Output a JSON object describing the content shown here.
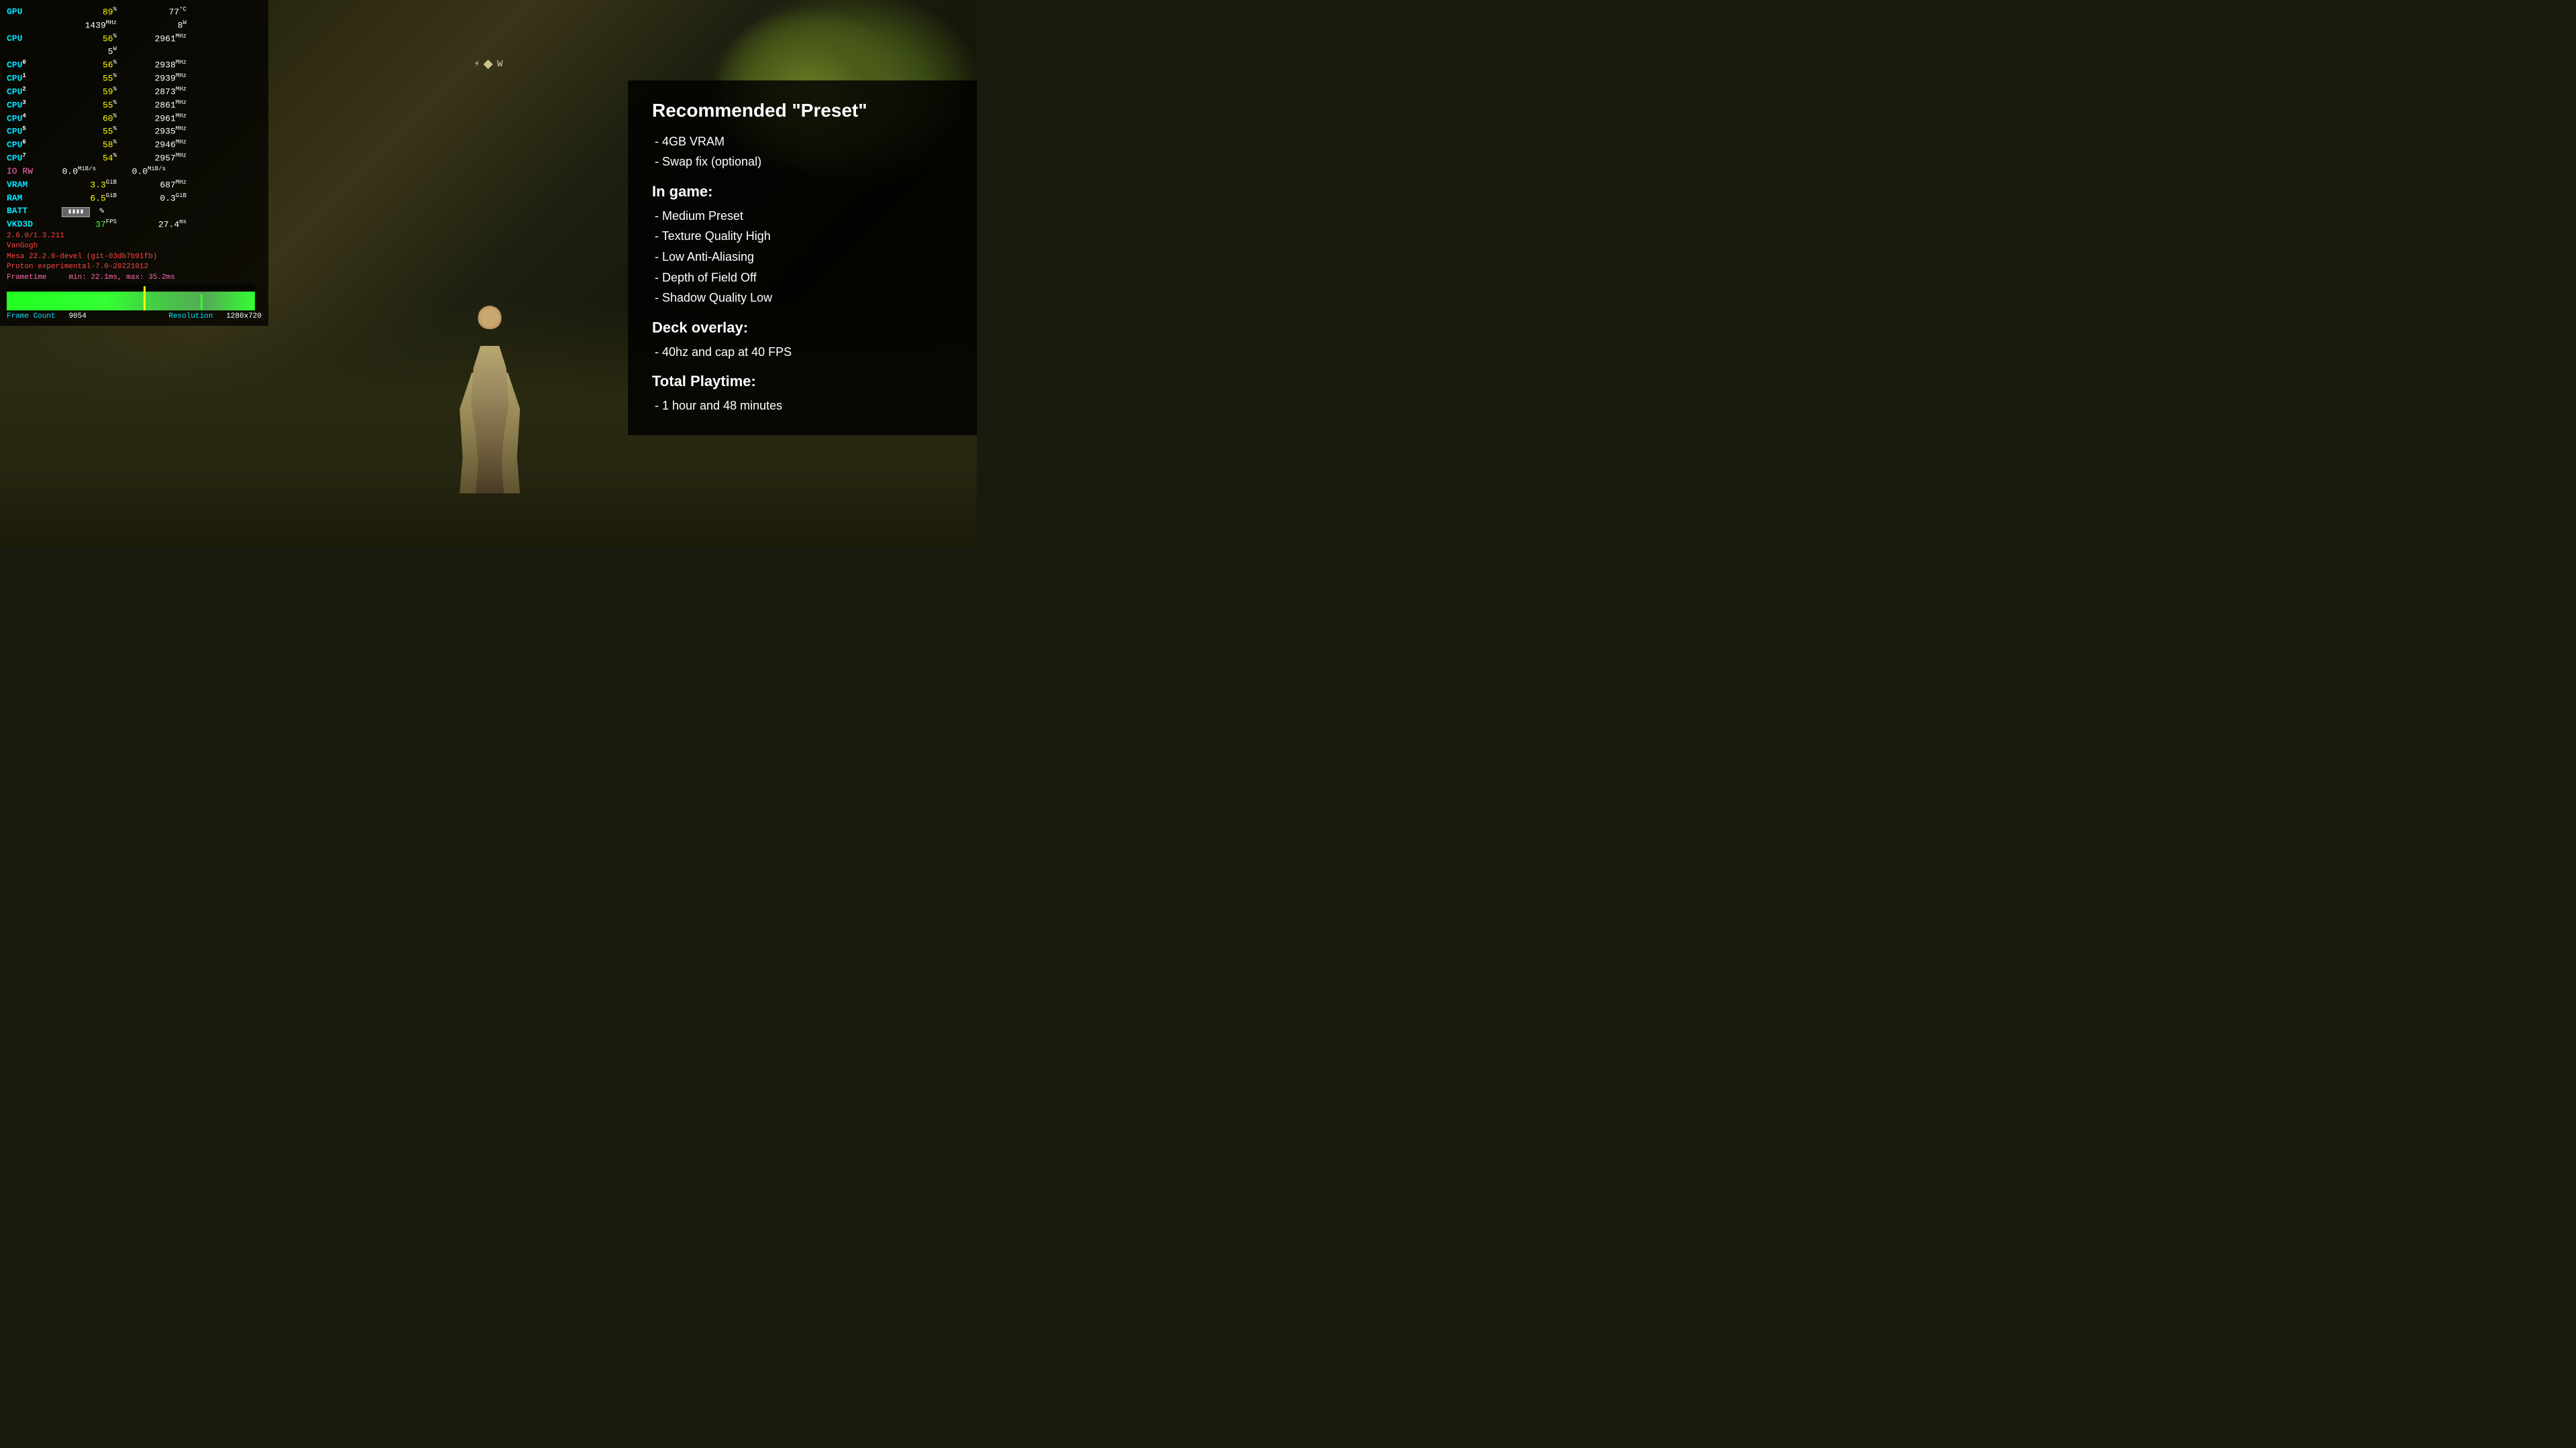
{
  "game_bg": {
    "description": "Dark forest game environment"
  },
  "perf": {
    "gpu_label": "GPU",
    "gpu_pct": "89",
    "gpu_pct_unit": "%",
    "gpu_temp": "77",
    "gpu_temp_unit": "°C",
    "gpu_freq": "1439",
    "gpu_freq_unit": "MHz",
    "gpu_power": "8",
    "gpu_power_unit": "W",
    "cpu_label": "CPU",
    "cpu_pct": "56",
    "cpu_pct_unit": "%",
    "cpu_freq": "2961",
    "cpu_freq_unit": "MHz",
    "cpu_power": "5",
    "cpu_power_unit": "W",
    "cpu_cores": [
      {
        "index": "0",
        "pct": "56",
        "freq": "2938"
      },
      {
        "index": "1",
        "pct": "55",
        "freq": "2939"
      },
      {
        "index": "2",
        "pct": "59",
        "freq": "2873"
      },
      {
        "index": "3",
        "pct": "55",
        "freq": "2861"
      },
      {
        "index": "4",
        "pct": "60",
        "freq": "2961"
      },
      {
        "index": "5",
        "pct": "55",
        "freq": "2935"
      },
      {
        "index": "6",
        "pct": "58",
        "freq": "2946"
      },
      {
        "index": "7",
        "pct": "54",
        "freq": "2957"
      }
    ],
    "io_label": "IO RW",
    "io_read": "0.0",
    "io_read_unit": "MiB/s",
    "io_write": "0.0",
    "io_write_unit": "MiB/s",
    "vram_label": "VRAM",
    "vram_used": "3.3",
    "vram_used_unit": "GiB",
    "vram_freq": "687",
    "vram_freq_unit": "MHz",
    "ram_label": "RAM",
    "ram_used": "6.5",
    "ram_used_unit": "GiB",
    "ram_swap": "0.3",
    "ram_swap_unit": "GiB",
    "batt_label": "BATT",
    "vkd3d_label": "VKD3D",
    "fps": "37",
    "fps_unit": "FPS",
    "frametime": "27.4",
    "frametime_unit": "ms",
    "version": "2.6.0/1.3.211",
    "driver": "VanGogh",
    "mesa": "Mesa 22.2.0-devel (git-03db7b91fb)",
    "proton": "Proton experimental-7.0-20221012",
    "ft_label": "Frametime",
    "ft_min": "min: 22.1ms",
    "ft_max": "max: 35.2ms",
    "frame_count_label": "Frame Count",
    "frame_count": "9054",
    "resolution_label": "Resolution",
    "resolution": "1280x720"
  },
  "info": {
    "title": "Recommended \"Preset\"",
    "preset_label": "- 4GB VRAM",
    "preset_swap": "- Swap fix (optional)",
    "in_game_title": "In game:",
    "in_game_items": [
      "- Medium Preset",
      "- Texture Quality High",
      "- Low Anti-Aliasing",
      "- Depth of Field Off",
      "- Shadow Quality Low"
    ],
    "deck_title": "Deck overlay:",
    "deck_items": [
      "- 40hz and cap at 40 FPS"
    ],
    "playtime_title": "Total Playtime:",
    "playtime_items": [
      "- 1 hour and 48 minutes"
    ]
  }
}
